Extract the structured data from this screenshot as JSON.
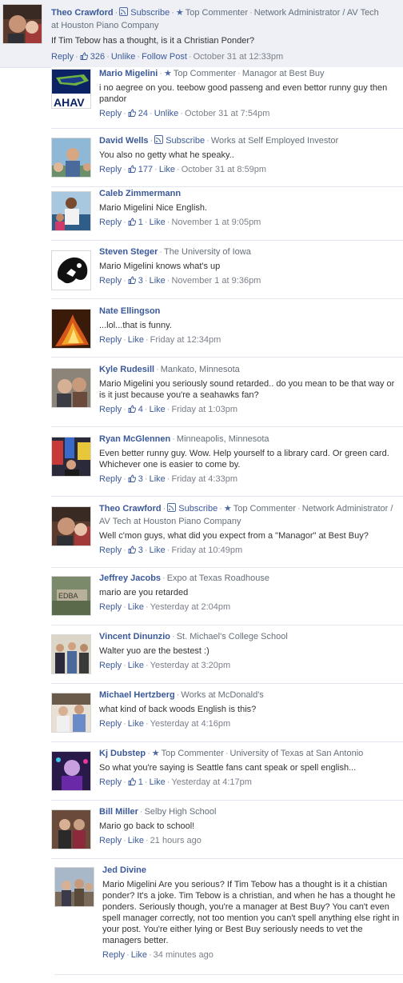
{
  "top_comment": {
    "name": "Theo Crawford",
    "subscribe": "Subscribe",
    "top_commenter": "Top Commenter",
    "work_line1": "Network Administrator / AV Tech",
    "work_line2": "at Houston Piano Company",
    "text": "If Tim Tebow has a thought, is it a Christian Ponder?",
    "actions": {
      "reply": "Reply",
      "likes": "326",
      "unlike": "Unlike",
      "follow": "Follow Post",
      "time": "October 31 at 12:33pm"
    }
  },
  "replies": [
    {
      "name": "Mario Migelini",
      "top_commenter": "Top Commenter",
      "work": "Managor at Best Buy",
      "text": "i no aegree on you. teebow good passeng and even bettor runny guy then pandor",
      "reply": "Reply",
      "likes": "24",
      "like_action": "Unlike",
      "time": "October 31 at 7:54pm"
    },
    {
      "name": "David Wells",
      "subscribe": "Subscribe",
      "work": "Works at Self Employed Investor",
      "text": "You also no getty what he speaky..",
      "reply": "Reply",
      "likes": "177",
      "like_action": "Like",
      "time": "October 31 at 8:59pm"
    },
    {
      "name": "Caleb Zimmermann",
      "text": "Mario Migelini Nice English.",
      "reply": "Reply",
      "likes": "1",
      "like_action": "Like",
      "time": "November 1 at 9:05pm"
    },
    {
      "name": "Steven Steger",
      "work": "The University of Iowa",
      "text": "Mario Migelini knows what's up",
      "reply": "Reply",
      "likes": "3",
      "like_action": "Like",
      "time": "November 1 at 9:36pm"
    },
    {
      "name": "Nate Ellingson",
      "text": "...lol...that is funny.",
      "reply": "Reply",
      "like_action": "Like",
      "time": "Friday at 12:34pm"
    },
    {
      "name": "Kyle Rudesill",
      "work": "Mankato, Minnesota",
      "text": "Mario Migelini you seriously sound retarded.. do you mean to be that way or is it just because you're a seahawks fan?",
      "reply": "Reply",
      "likes": "4",
      "like_action": "Like",
      "time": "Friday at 1:03pm"
    },
    {
      "name": "Ryan McGlennen",
      "work": "Minneapolis, Minnesota",
      "text": "Even better runny guy. Wow. Help yourself to a library card. Or green card. Whichever one is easier to come by.",
      "reply": "Reply",
      "likes": "3",
      "like_action": "Like",
      "time": "Friday at 4:33pm"
    },
    {
      "name": "Theo Crawford",
      "subscribe": "Subscribe",
      "top_commenter": "Top Commenter",
      "work": "Network Administrator / AV Tech at Houston Piano Company",
      "text": "Well c'mon guys, what did you expect from a \"Managor\" at Best Buy?",
      "reply": "Reply",
      "likes": "3",
      "like_action": "Like",
      "time": "Friday at 10:49pm"
    },
    {
      "name": "Jeffrey Jacobs",
      "work": "Expo at Texas Roadhouse",
      "text": "mario are you retarded",
      "reply": "Reply",
      "like_action": "Like",
      "time": "Yesterday at 2:04pm"
    },
    {
      "name": "Vincent Dinunzio",
      "work": "St. Michael's College School",
      "text": "Walter yuo are the bestest :)",
      "reply": "Reply",
      "like_action": "Like",
      "time": "Yesterday at 3:20pm"
    },
    {
      "name": "Michael Hertzberg",
      "work": "Works at McDonald's",
      "text": "what kind of back woods English is this?",
      "reply": "Reply",
      "like_action": "Like",
      "time": "Yesterday at 4:16pm"
    },
    {
      "name": "Kj Dubstep",
      "top_commenter": "Top Commenter",
      "work": "University of Texas at San Antonio",
      "text": "So what you're saying is Seattle fans cant speak or spell english...",
      "reply": "Reply",
      "likes": "1",
      "like_action": "Like",
      "time": "Yesterday at 4:17pm"
    },
    {
      "name": "Bill Miller",
      "work": "Selby High School",
      "text": "Mario go back to school!",
      "reply": "Reply",
      "like_action": "Like",
      "time": "21 hours ago"
    },
    {
      "name": "Jed Divine",
      "text": "Mario Migelini Are you serious? If Tim Tebow has a thought is it a chistian ponder? It's a joke. Tim Tebow is a christian, and when he has a thought he ponders. Seriously though, you're a manager at Best Buy? You can't even spell manager correctly, not too mention you can't spell anything else right in your post. You're either lying or Best Buy seriously needs to vet the managers better.",
      "reply": "Reply",
      "like_action": "Like",
      "time": "34 minutes ago"
    }
  ],
  "colors": {
    "link": "#3b5998",
    "meta_gray": "#666f7a",
    "top_bg": "#eef0f6",
    "divider": "#e3e6ee"
  }
}
